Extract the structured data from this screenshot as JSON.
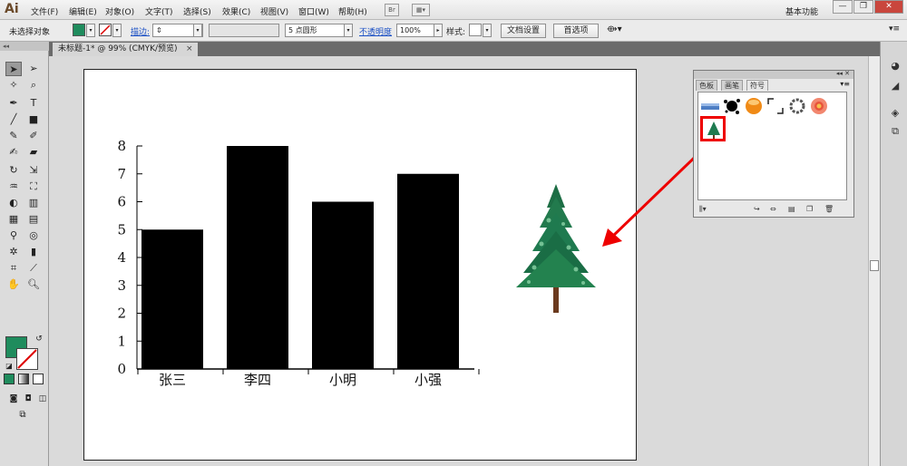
{
  "app": {
    "logo": "Ai",
    "menu": [
      "文件(F)",
      "编辑(E)",
      "对象(O)",
      "文字(T)",
      "选择(S)",
      "效果(C)",
      "视图(V)",
      "窗口(W)",
      "帮助(H)"
    ],
    "bridge_label": "Br",
    "workspace": "基本功能",
    "win_minimize": "—",
    "win_restore": "❐",
    "win_close": "✕"
  },
  "control": {
    "selection_label": "未选择对象",
    "fill_color": "#1f8c5d",
    "stroke_label": "描边:",
    "brush_label": "5 点圆形",
    "opacity_label": "不透明度",
    "opacity_value": "100%",
    "style_label": "样式:",
    "doc_setup": "文档设置",
    "preferences": "首选项"
  },
  "document": {
    "tab_title": "未标题-1* @ 99% (CMYK/预览)",
    "tab_close": "×"
  },
  "tools": {
    "header": "◂◂"
  },
  "symbols_panel": {
    "collapse": "◂◂ ✕",
    "tabs": [
      "色板",
      "画笔",
      "符号"
    ],
    "active_tab": "符号",
    "menu": "▾≡",
    "symbols": [
      "blue-banner-symbol",
      "ink-splash-symbol",
      "orange-button-symbol",
      "corner-frame-symbol",
      "wreath-symbol",
      "flower-symbol",
      "tree-symbol"
    ],
    "selected_symbol": "tree-symbol",
    "footer_icons": [
      "symbol-library-icon",
      "place-instance-icon",
      "break-link-icon",
      "symbol-options-icon",
      "new-symbol-icon",
      "delete-symbol-icon"
    ]
  },
  "accent_colors": {
    "highlight_red": "#e00000",
    "tree_green": "#1f7a4f"
  },
  "chart_data": {
    "type": "bar",
    "categories": [
      "张三",
      "李四",
      "小明",
      "小强"
    ],
    "values": [
      5,
      8,
      6,
      7
    ],
    "y_ticks": [
      "0",
      "1",
      "2",
      "3",
      "4",
      "5",
      "6",
      "7",
      "8"
    ],
    "ylim": [
      0,
      8
    ],
    "bar_color": "#000000"
  }
}
